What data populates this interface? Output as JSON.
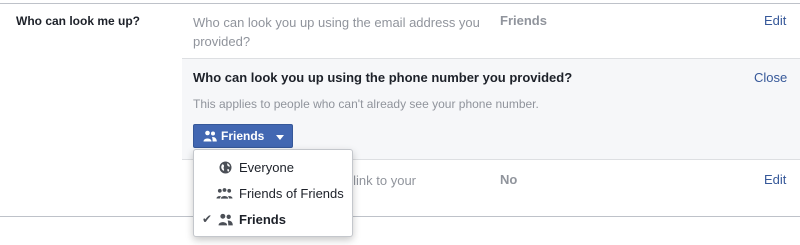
{
  "section": {
    "label": "Who can look me up?"
  },
  "row_email": {
    "question": "Who can look you up using the email address you provided?",
    "value": "Friends",
    "edit": "Edit"
  },
  "row_phone": {
    "title": "Who can look you up using the phone number you provided?",
    "close": "Close",
    "note": "This applies to people who can't already see your phone number.",
    "button_label": "Friends"
  },
  "row_search": {
    "question_visible": "gines to link to your",
    "value": "No",
    "edit": "Edit"
  },
  "dropdown": {
    "options": [
      {
        "label": "Everyone",
        "icon": "globe-icon",
        "selected": false
      },
      {
        "label": "Friends of Friends",
        "icon": "friends-of-friends-icon",
        "selected": false
      },
      {
        "label": "Friends",
        "icon": "friends-icon",
        "selected": true
      }
    ]
  },
  "colors": {
    "accent": "#4267b2",
    "link": "#365899",
    "muted": "#90949c"
  }
}
